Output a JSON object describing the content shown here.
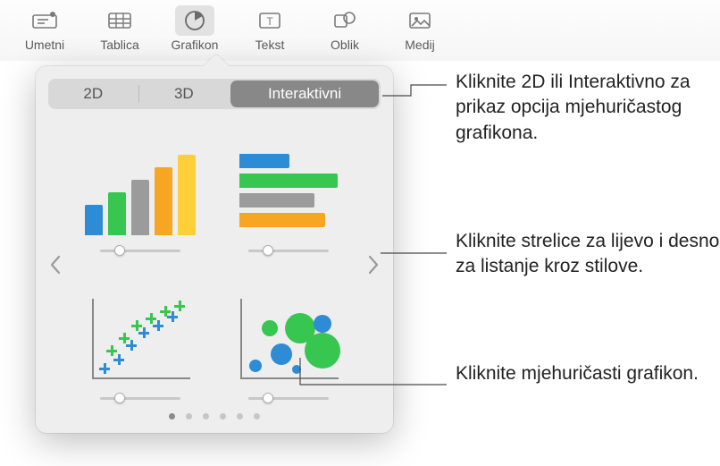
{
  "toolbar": {
    "items": [
      {
        "label": "Umetni"
      },
      {
        "label": "Tablica"
      },
      {
        "label": "Grafikon"
      },
      {
        "label": "Tekst"
      },
      {
        "label": "Oblik"
      },
      {
        "label": "Medij"
      }
    ]
  },
  "segmented": {
    "items": [
      "2D",
      "3D",
      "Interaktivni"
    ],
    "active": 2
  },
  "callouts": {
    "top": "Kliknite 2D ili Interaktivno za prikaz opcija mjehuričastog grafikona.",
    "mid": "Kliknite strelice za lijevo i desno za listanje kroz stilove.",
    "bottom": "Kliknite mjehuričasti grafikon."
  },
  "colors": {
    "blue": "#2e8bd6",
    "green": "#37c650",
    "teal": "#7ab648",
    "orange": "#f6a623",
    "yellow": "#ffcf3a",
    "gray": "#9b9b9b"
  },
  "page_dots": {
    "count": 6,
    "active": 0
  }
}
